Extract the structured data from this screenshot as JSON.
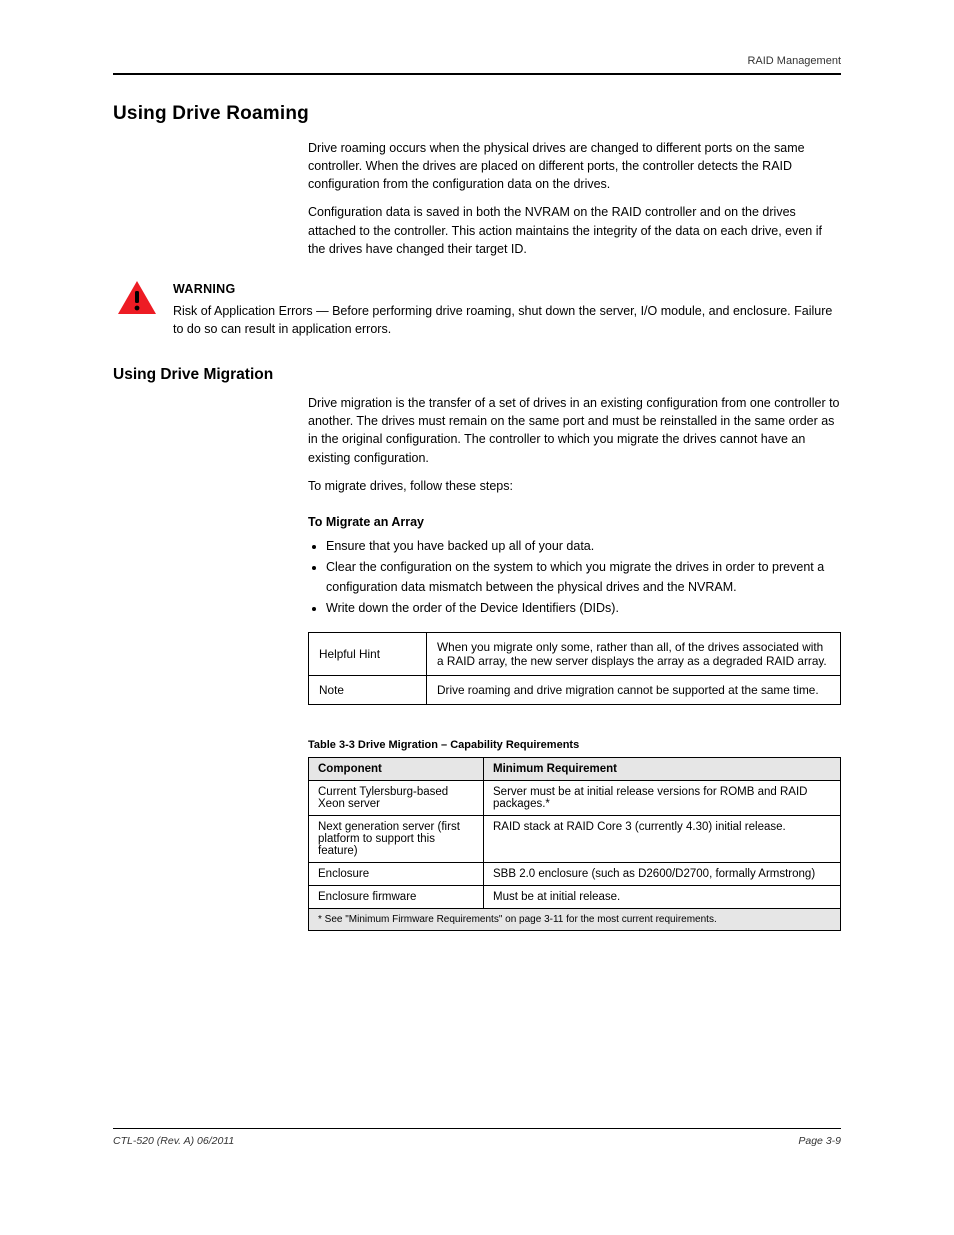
{
  "header": {
    "running_title": "RAID Management"
  },
  "section": {
    "title": "Using Drive Roaming",
    "intro": [
      "Drive roaming occurs when the physical drives are changed to different ports on the same controller. When the drives are placed on different ports, the controller detects the RAID configuration from the configuration data on the drives.",
      "Configuration data is saved in both the NVRAM on the RAID controller and on the drives attached to the controller. This action maintains the integrity of the data on each drive, even if the drives have changed their target ID."
    ],
    "warning": {
      "label": "WARNING",
      "text": "Risk of Application Errors — Before performing drive roaming, shut down the server, I/O module, and enclosure. Failure to do so can result in application errors."
    },
    "sub_title": "Using Drive Migration",
    "sub_paras": [
      "Drive migration is the transfer of a set of drives in an existing configuration from one controller to another. The drives must remain on the same port and must be reinstalled in the same order as in the original configuration. The controller to which you migrate the drives cannot have an existing configuration.",
      "To migrate drives, follow these steps:"
    ],
    "h3": "To Migrate an Array",
    "steps": [
      "Ensure that you have backed up all of your data.",
      "Clear the configuration on the system to which you migrate the drives in order to prevent a configuration data mismatch between the physical drives and the NVRAM.",
      "Write down the order of the Device Identifiers (DIDs)."
    ],
    "table1": {
      "rows": [
        {
          "left": "Helpful Hint",
          "right": "When you migrate only some, rather than all, of the drives associated with a RAID array, the new server displays the array as a degraded RAID array."
        },
        {
          "left": "Note",
          "right": "Drive roaming and drive migration cannot be supported at the same time."
        }
      ]
    },
    "table2": {
      "caption": "Table 3-3  Drive Migration – Capability Requirements",
      "headers": [
        "Component",
        "Minimum Requirement"
      ],
      "rows": [
        [
          "Current Tylersburg-based Xeon server",
          "Server must be at initial release versions for ROMB and RAID packages.*"
        ],
        [
          "Next generation server (first platform to support this feature)",
          "RAID stack at RAID Core 3 (currently 4.30) initial release."
        ],
        [
          "Enclosure",
          "SBB 2.0 enclosure (such as D2600/D2700, formally Armstrong)"
        ],
        [
          "Enclosure firmware",
          "Must be at initial release."
        ]
      ],
      "footnote": "* See \"Minimum Firmware Requirements\" on page 3-11 for the most current requirements."
    }
  },
  "footer": {
    "left": "CTL-520 (Rev. A)  06/2011",
    "right": "Page 3-9"
  }
}
